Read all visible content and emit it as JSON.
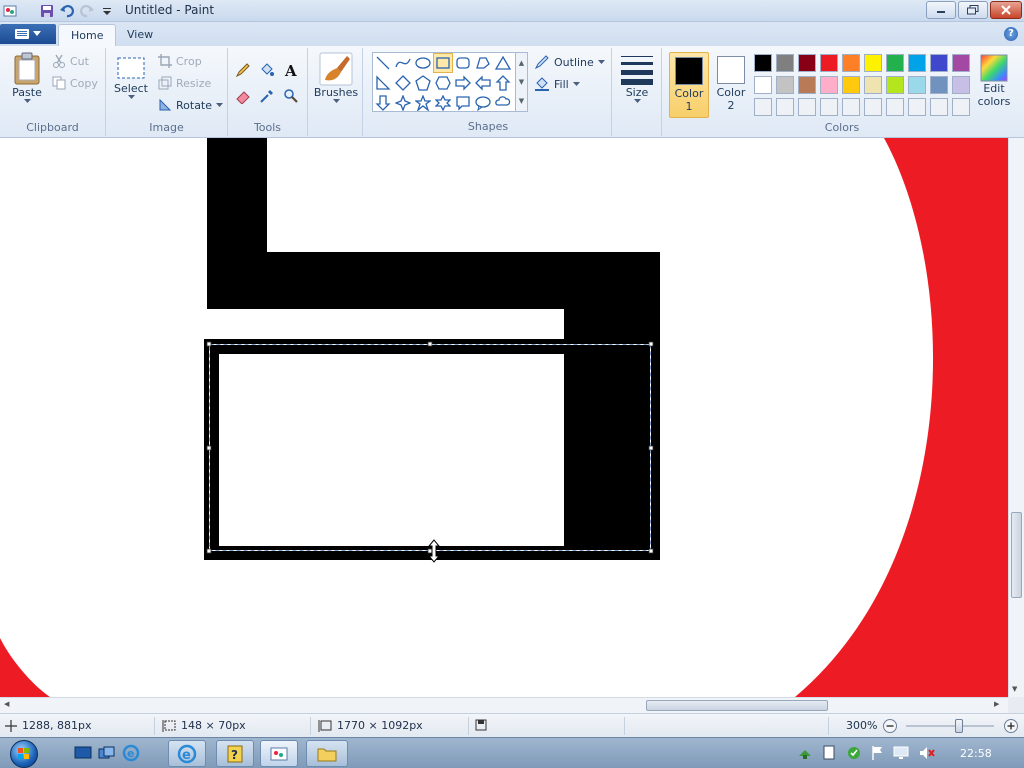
{
  "window": {
    "title": "Untitled - Paint"
  },
  "tabs": [
    {
      "label": "Home"
    },
    {
      "label": "View"
    }
  ],
  "help_label": "?",
  "ribbon": {
    "clipboard": {
      "group_label": "Clipboard",
      "paste": "Paste",
      "cut": "Cut",
      "copy": "Copy"
    },
    "image": {
      "group_label": "Image",
      "select": "Select",
      "crop": "Crop",
      "resize": "Resize",
      "rotate": "Rotate"
    },
    "tools": {
      "group_label": "Tools"
    },
    "brushes": {
      "label": "Brushes"
    },
    "shapes": {
      "group_label": "Shapes",
      "outline": "Outline",
      "fill": "Fill"
    },
    "size": {
      "label": "Size"
    },
    "colors": {
      "group_label": "Colors",
      "color1_line1": "Color",
      "color1_line2": "1",
      "color2_line1": "Color",
      "color2_line2": "2",
      "edit_line1": "Edit",
      "edit_line2": "colors",
      "color1_value": "#000000",
      "color2_value": "#ffffff",
      "palette_row1": [
        "#000000",
        "#7f7f7f",
        "#880015",
        "#ed1c24",
        "#ff7f27",
        "#fff200",
        "#22b14c",
        "#00a2e8",
        "#3f48cc",
        "#a349a4"
      ],
      "palette_row2": [
        "#ffffff",
        "#c3c3c3",
        "#b97a57",
        "#ffaec9",
        "#ffc90e",
        "#efe4b0",
        "#b5e61d",
        "#99d9ea",
        "#7092be",
        "#c8bfe7"
      ],
      "palette_row3_empty": 10
    }
  },
  "canvas": {
    "background": "#ffffff",
    "accent_red": "#ed1c24",
    "shape_fill": "#000000"
  },
  "statusbar": {
    "cursor_pos": "1288, 881px",
    "selection_size": "148 × 70px",
    "image_size": "1770 × 1092px",
    "zoom": "300%"
  },
  "taskbar": {
    "clock": "22:58"
  }
}
